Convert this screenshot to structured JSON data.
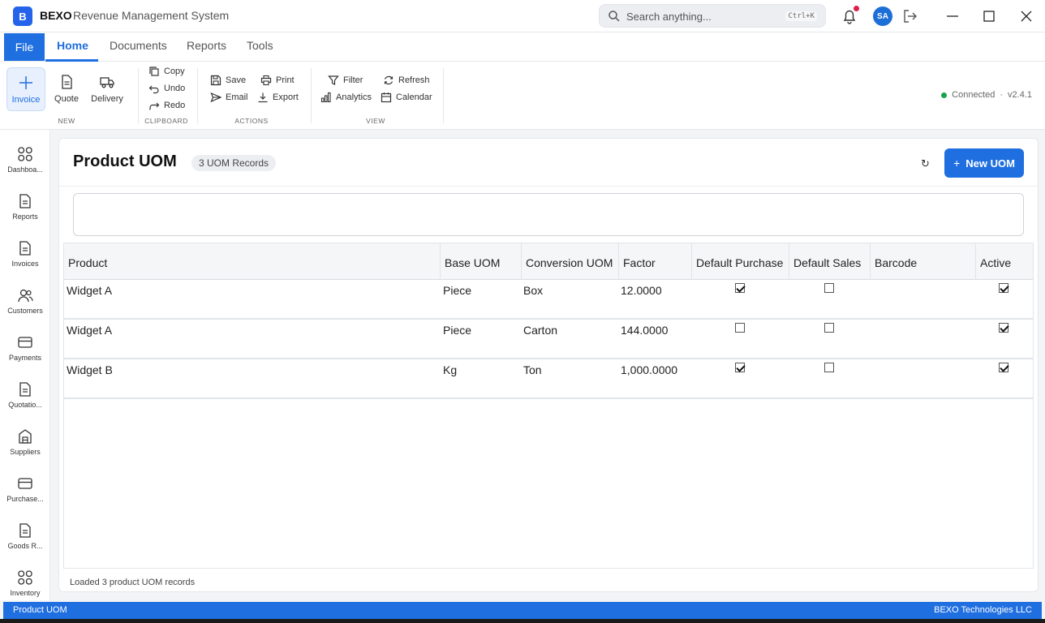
{
  "app": {
    "logo_letter": "B",
    "name": "BEXO",
    "subtitle": "Revenue Management System"
  },
  "search": {
    "placeholder": "Search anything...",
    "shortcut": "Ctrl+K"
  },
  "user": {
    "initials": "SA"
  },
  "menu": {
    "file": "File",
    "tabs": [
      "Home",
      "Documents",
      "Reports",
      "Tools"
    ],
    "active_tab": "Home"
  },
  "ribbon": {
    "new": {
      "label": "NEW",
      "items": [
        "Invoice",
        "Quote",
        "Delivery"
      ]
    },
    "clipboard": {
      "label": "CLIPBOARD",
      "items": [
        "Copy",
        "Undo",
        "Redo"
      ]
    },
    "actions": {
      "label": "ACTIONS",
      "items": [
        "Save",
        "Print",
        "Email",
        "Export"
      ]
    },
    "view": {
      "label": "VIEW",
      "items": [
        "Filter",
        "Refresh",
        "Analytics",
        "Calendar"
      ]
    },
    "connection": {
      "status": "Connected",
      "separator": "·",
      "version": "v2.4.1"
    }
  },
  "sidebar": {
    "items": [
      "Dashboa...",
      "Reports",
      "Invoices",
      "Customers",
      "Payments",
      "Quotatio...",
      "Suppliers",
      "Purchase...",
      "Goods R...",
      "Inventory"
    ]
  },
  "page": {
    "title": "Product UOM",
    "badge": "3  UOM Records",
    "new_button": "New UOM",
    "refresh_glyph": "↻"
  },
  "table": {
    "columns": [
      "Product",
      "Base UOM",
      "Conversion UOM",
      "Factor",
      "Default Purchase",
      "Default Sales",
      "Barcode",
      "Active"
    ],
    "rows": [
      {
        "product": "Widget A",
        "base_uom": "Piece",
        "conversion_uom": "Box",
        "factor": "12.0000",
        "default_purchase": true,
        "default_sales": false,
        "barcode": "",
        "active": true
      },
      {
        "product": "Widget A",
        "base_uom": "Piece",
        "conversion_uom": "Carton",
        "factor": "144.0000",
        "default_purchase": false,
        "default_sales": false,
        "barcode": "",
        "active": true
      },
      {
        "product": "Widget B",
        "base_uom": "Kg",
        "conversion_uom": "Ton",
        "factor": "1,000.0000",
        "default_purchase": true,
        "default_sales": false,
        "barcode": "",
        "active": true
      }
    ]
  },
  "status_message": "Loaded 3 product UOM records",
  "statusbar": {
    "left": "Product UOM",
    "right": "BEXO Technologies LLC"
  },
  "colors": {
    "accent": "#1f6fe0",
    "connected": "#16a34a",
    "notification": "#e11d48"
  }
}
